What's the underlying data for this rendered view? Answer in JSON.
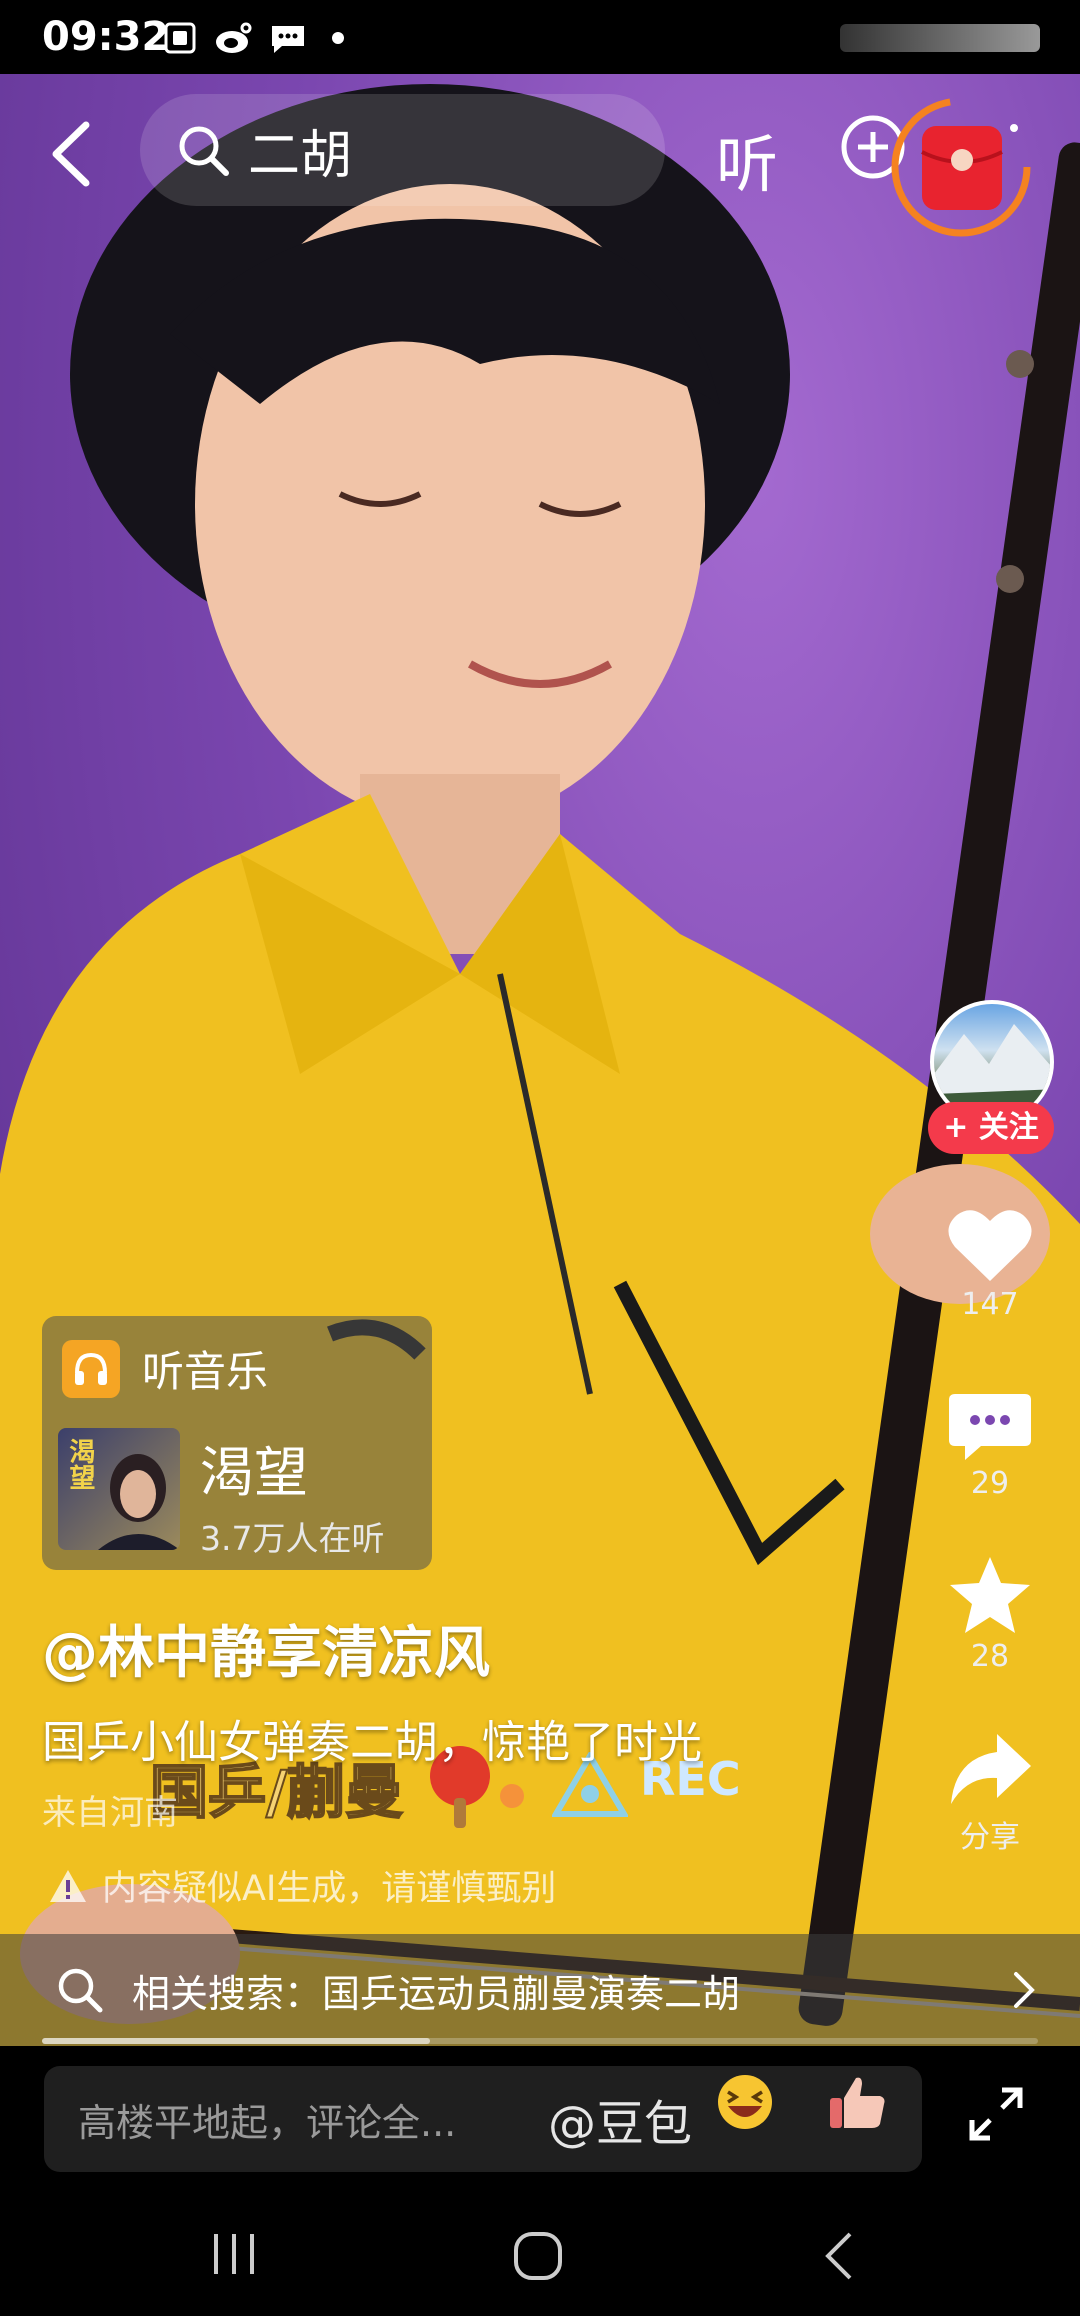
{
  "status_bar": {
    "time": "09:32",
    "icons": [
      "screenshot-icon",
      "weibo-icon",
      "message-icon",
      "dot-icon"
    ]
  },
  "top_nav": {
    "search_query": "二胡",
    "listen_label": "听",
    "icons": [
      "back-icon",
      "search-icon",
      "plus-icon",
      "red-packet-icon"
    ]
  },
  "right_rail": {
    "follow_label": "+ 关注",
    "likes": "147",
    "comments": "29",
    "favorites": "28",
    "share_label": "分享"
  },
  "music_card": {
    "header": "听音乐",
    "cover_text": "渴望",
    "song_title": "渴望",
    "listeners": "3.7万人在听"
  },
  "post": {
    "author": "@林中静享清凉风",
    "description": "国乒小仙女弹奏二胡，惊艳了时光",
    "location": "来自河南",
    "ai_warning": "内容疑似AI生成，请谨慎甄别"
  },
  "video_overlay": {
    "caption": "国乒/蒯曼",
    "rec_label": "REC"
  },
  "related_search": {
    "text": "相关搜索：国乒运动员蒯曼演奏二胡"
  },
  "playback": {
    "progress": 0.39
  },
  "comment_bar": {
    "placeholder": "高楼平地起，评论全...",
    "mention": "@豆包"
  },
  "colors": {
    "accent_red": "#f43a4b",
    "background_purple": "#7b47b0",
    "music_icon_orange": "#f5a524"
  }
}
